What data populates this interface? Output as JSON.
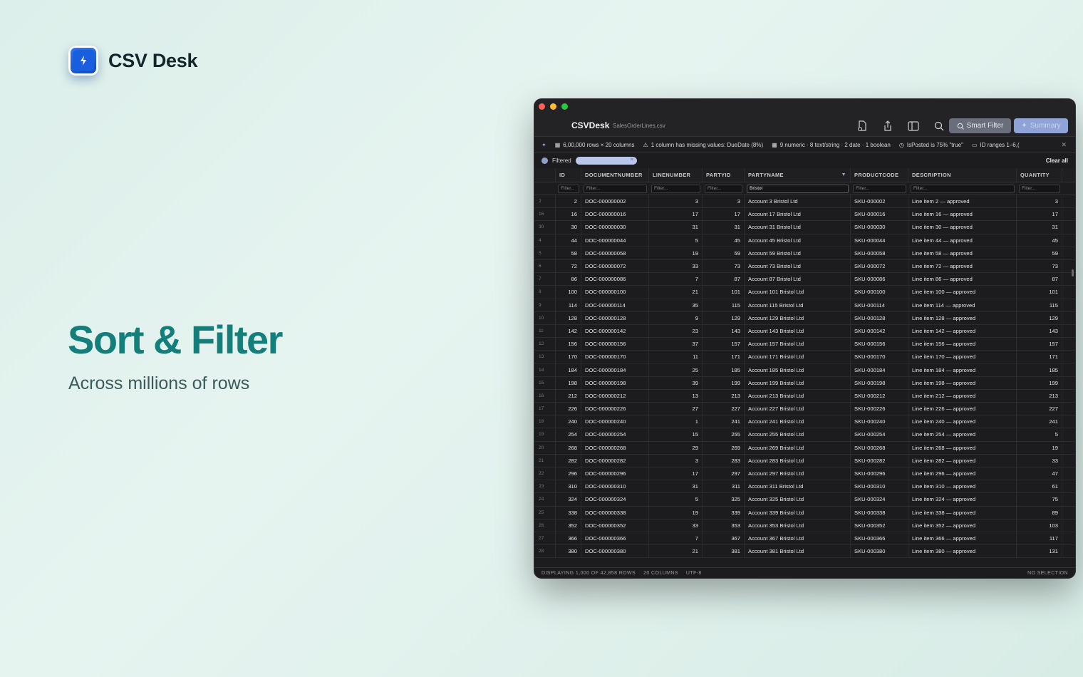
{
  "brand": {
    "name": "CSV Desk"
  },
  "hero": {
    "title": "Sort & Filter",
    "subtitle": "Across millions of rows"
  },
  "window": {
    "app_title": "CSVDesk",
    "file_name": "SalesOrderLines.csv",
    "smart_filter_label": "Smart Filter",
    "summary_label": "Summary"
  },
  "info": {
    "rows_cols": "6,00,000 rows × 20 columns",
    "missing": "1 column has missing values: DueDate (8%)",
    "types": "9 numeric · 8 text/string · 2 date · 1 boolean",
    "posted": "IsPosted is 75% \"true\"",
    "ranges": "ID ranges 1–6,("
  },
  "filter": {
    "label": "Filtered",
    "clear_all": "Clear all"
  },
  "columns": [
    "ID",
    "DOCUMENTNUMBER",
    "LINENUMBER",
    "PARTYID",
    "PARTYNAME",
    "PRODUCTCODE",
    "DESCRIPTION",
    "QUANTITY"
  ],
  "filter_placeholder": "Filter...",
  "partyname_filter": "Bristol",
  "rows": [
    {
      "rn": "2",
      "id": "2",
      "doc": "DOC-000000002",
      "ln": "3",
      "pid": "3",
      "pn": "Account 3 Bristol Ltd",
      "pc": "SKU-000002",
      "desc": "Line item 2 — approved",
      "qty": "3"
    },
    {
      "rn": "16",
      "id": "16",
      "doc": "DOC-000000016",
      "ln": "17",
      "pid": "17",
      "pn": "Account 17 Bristol Ltd",
      "pc": "SKU-000016",
      "desc": "Line item 16 — approved",
      "qty": "17"
    },
    {
      "rn": "30",
      "id": "30",
      "doc": "DOC-000000030",
      "ln": "31",
      "pid": "31",
      "pn": "Account 31 Bristol Ltd",
      "pc": "SKU-000030",
      "desc": "Line item 30 — approved",
      "qty": "31"
    },
    {
      "rn": "4",
      "id": "44",
      "doc": "DOC-000000044",
      "ln": "5",
      "pid": "45",
      "pn": "Account 45 Bristol Ltd",
      "pc": "SKU-000044",
      "desc": "Line item 44 — approved",
      "qty": "45"
    },
    {
      "rn": "5",
      "id": "58",
      "doc": "DOC-000000058",
      "ln": "19",
      "pid": "59",
      "pn": "Account 59 Bristol Ltd",
      "pc": "SKU-000058",
      "desc": "Line item 58 — approved",
      "qty": "59"
    },
    {
      "rn": "6",
      "id": "72",
      "doc": "DOC-000000072",
      "ln": "33",
      "pid": "73",
      "pn": "Account 73 Bristol Ltd",
      "pc": "SKU-000072",
      "desc": "Line item 72 — approved",
      "qty": "73"
    },
    {
      "rn": "7",
      "id": "86",
      "doc": "DOC-000000086",
      "ln": "7",
      "pid": "87",
      "pn": "Account 87 Bristol Ltd",
      "pc": "SKU-000086",
      "desc": "Line item 86 — approved",
      "qty": "87"
    },
    {
      "rn": "8",
      "id": "100",
      "doc": "DOC-000000100",
      "ln": "21",
      "pid": "101",
      "pn": "Account 101 Bristol Ltd",
      "pc": "SKU-000100",
      "desc": "Line item 100 — approved",
      "qty": "101"
    },
    {
      "rn": "9",
      "id": "114",
      "doc": "DOC-000000114",
      "ln": "35",
      "pid": "115",
      "pn": "Account 115 Bristol Ltd",
      "pc": "SKU-000114",
      "desc": "Line item 114 — approved",
      "qty": "115"
    },
    {
      "rn": "10",
      "id": "128",
      "doc": "DOC-000000128",
      "ln": "9",
      "pid": "129",
      "pn": "Account 129 Bristol Ltd",
      "pc": "SKU-000128",
      "desc": "Line item 128 — approved",
      "qty": "129"
    },
    {
      "rn": "11",
      "id": "142",
      "doc": "DOC-000000142",
      "ln": "23",
      "pid": "143",
      "pn": "Account 143 Bristol Ltd",
      "pc": "SKU-000142",
      "desc": "Line item 142 — approved",
      "qty": "143"
    },
    {
      "rn": "12",
      "id": "156",
      "doc": "DOC-000000156",
      "ln": "37",
      "pid": "157",
      "pn": "Account 157 Bristol Ltd",
      "pc": "SKU-000156",
      "desc": "Line item 156 — approved",
      "qty": "157"
    },
    {
      "rn": "13",
      "id": "170",
      "doc": "DOC-000000170",
      "ln": "11",
      "pid": "171",
      "pn": "Account 171 Bristol Ltd",
      "pc": "SKU-000170",
      "desc": "Line item 170 — approved",
      "qty": "171"
    },
    {
      "rn": "14",
      "id": "184",
      "doc": "DOC-000000184",
      "ln": "25",
      "pid": "185",
      "pn": "Account 185 Bristol Ltd",
      "pc": "SKU-000184",
      "desc": "Line item 184 — approved",
      "qty": "185"
    },
    {
      "rn": "15",
      "id": "198",
      "doc": "DOC-000000198",
      "ln": "39",
      "pid": "199",
      "pn": "Account 199 Bristol Ltd",
      "pc": "SKU-000198",
      "desc": "Line item 198 — approved",
      "qty": "199"
    },
    {
      "rn": "16",
      "id": "212",
      "doc": "DOC-000000212",
      "ln": "13",
      "pid": "213",
      "pn": "Account 213 Bristol Ltd",
      "pc": "SKU-000212",
      "desc": "Line item 212 — approved",
      "qty": "213"
    },
    {
      "rn": "17",
      "id": "226",
      "doc": "DOC-000000226",
      "ln": "27",
      "pid": "227",
      "pn": "Account 227 Bristol Ltd",
      "pc": "SKU-000226",
      "desc": "Line item 226 — approved",
      "qty": "227"
    },
    {
      "rn": "18",
      "id": "240",
      "doc": "DOC-000000240",
      "ln": "1",
      "pid": "241",
      "pn": "Account 241 Bristol Ltd",
      "pc": "SKU-000240",
      "desc": "Line item 240 — approved",
      "qty": "241"
    },
    {
      "rn": "19",
      "id": "254",
      "doc": "DOC-000000254",
      "ln": "15",
      "pid": "255",
      "pn": "Account 255 Bristol Ltd",
      "pc": "SKU-000254",
      "desc": "Line item 254 — approved",
      "qty": "5"
    },
    {
      "rn": "20",
      "id": "268",
      "doc": "DOC-000000268",
      "ln": "29",
      "pid": "269",
      "pn": "Account 269 Bristol Ltd",
      "pc": "SKU-000268",
      "desc": "Line item 268 — approved",
      "qty": "19"
    },
    {
      "rn": "21",
      "id": "282",
      "doc": "DOC-000000282",
      "ln": "3",
      "pid": "283",
      "pn": "Account 283 Bristol Ltd",
      "pc": "SKU-000282",
      "desc": "Line item 282 — approved",
      "qty": "33"
    },
    {
      "rn": "22",
      "id": "296",
      "doc": "DOC-000000296",
      "ln": "17",
      "pid": "297",
      "pn": "Account 297 Bristol Ltd",
      "pc": "SKU-000296",
      "desc": "Line item 296 — approved",
      "qty": "47"
    },
    {
      "rn": "23",
      "id": "310",
      "doc": "DOC-000000310",
      "ln": "31",
      "pid": "311",
      "pn": "Account 311 Bristol Ltd",
      "pc": "SKU-000310",
      "desc": "Line item 310 — approved",
      "qty": "61"
    },
    {
      "rn": "24",
      "id": "324",
      "doc": "DOC-000000324",
      "ln": "5",
      "pid": "325",
      "pn": "Account 325 Bristol Ltd",
      "pc": "SKU-000324",
      "desc": "Line item 324 — approved",
      "qty": "75"
    },
    {
      "rn": "25",
      "id": "338",
      "doc": "DOC-000000338",
      "ln": "19",
      "pid": "339",
      "pn": "Account 339 Bristol Ltd",
      "pc": "SKU-000338",
      "desc": "Line item 338 — approved",
      "qty": "89"
    },
    {
      "rn": "26",
      "id": "352",
      "doc": "DOC-000000352",
      "ln": "33",
      "pid": "353",
      "pn": "Account 353 Bristol Ltd",
      "pc": "SKU-000352",
      "desc": "Line item 352 — approved",
      "qty": "103"
    },
    {
      "rn": "27",
      "id": "366",
      "doc": "DOC-000000366",
      "ln": "7",
      "pid": "367",
      "pn": "Account 367 Bristol Ltd",
      "pc": "SKU-000366",
      "desc": "Line item 366 — approved",
      "qty": "117"
    },
    {
      "rn": "28",
      "id": "380",
      "doc": "DOC-000000380",
      "ln": "21",
      "pid": "381",
      "pn": "Account 381 Bristol Ltd",
      "pc": "SKU-000380",
      "desc": "Line item 380 — approved",
      "qty": "131"
    }
  ],
  "status": {
    "displaying": "DISPLAYING 1,000 OF 42,858 ROWS",
    "columns": "20 COLUMNS",
    "encoding": "UTF-8",
    "selection": "NO SELECTION"
  }
}
